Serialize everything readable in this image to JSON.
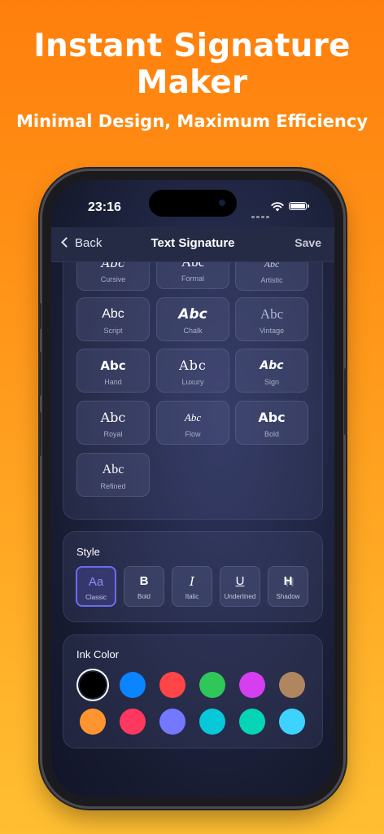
{
  "promo": {
    "headline_line1": "Instant Signature",
    "headline_line2": "Maker",
    "subline": "Minimal Design, Maximum Efficiency"
  },
  "status_bar": {
    "time": "23:16"
  },
  "navbar": {
    "back_label": "Back",
    "title": "Text Signature",
    "save_label": "Save"
  },
  "fonts": [
    {
      "sample": "Abc",
      "name": "Cursive"
    },
    {
      "sample": "Abc",
      "name": "Formal"
    },
    {
      "sample": "Abc",
      "name": "Artistic"
    },
    {
      "sample": "Abc",
      "name": "Script"
    },
    {
      "sample": "Abc",
      "name": "Chalk"
    },
    {
      "sample": "Abc",
      "name": "Vintage"
    },
    {
      "sample": "Abc",
      "name": "Hand"
    },
    {
      "sample": "Abc",
      "name": "Luxury"
    },
    {
      "sample": "Abc",
      "name": "Sign"
    },
    {
      "sample": "Abc",
      "name": "Royal"
    },
    {
      "sample": "Abc",
      "name": "Flow"
    },
    {
      "sample": "Abc",
      "name": "Bold"
    },
    {
      "sample": "Abc",
      "name": "Refined"
    }
  ],
  "style_section": {
    "title": "Style",
    "options": [
      {
        "glyph": "Aa",
        "label": "Classic",
        "selected": true
      },
      {
        "glyph": "B",
        "label": "Bold",
        "selected": false
      },
      {
        "glyph": "I",
        "label": "Italic",
        "selected": false
      },
      {
        "glyph": "U",
        "label": "Underlined",
        "selected": false
      },
      {
        "glyph": "H",
        "label": "Shadow",
        "selected": false
      }
    ]
  },
  "ink_section": {
    "title": "Ink Color",
    "selected_index": 0,
    "colors": [
      "#000000",
      "#0a84ff",
      "#ff4545",
      "#30c75a",
      "#d63ff0",
      "#b08660",
      "#ff9430",
      "#ff3860",
      "#7378ff",
      "#07c8d8",
      "#06d4b6",
      "#3ed2ff"
    ]
  },
  "theme": {
    "accent": "#6b6cf0",
    "promo_orange": "#ff7f0c",
    "promo_yellow": "#ffbf32"
  }
}
